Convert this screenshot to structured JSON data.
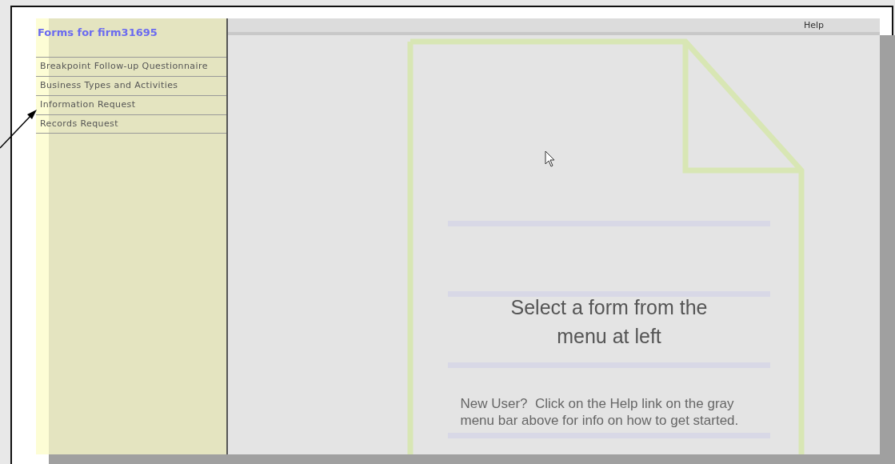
{
  "sidebar": {
    "title": "Forms for firm31695",
    "items": [
      {
        "label": "Breakpoint Follow-up Questionnaire"
      },
      {
        "label": "Business Types and Activities"
      },
      {
        "label": "Information Request"
      },
      {
        "label": "Records Request"
      }
    ]
  },
  "menu_bar": {
    "items": [
      "Help"
    ]
  },
  "main": {
    "heading": "Select a form from the menu at left",
    "hint": "New User?  Click on the Help link on the gray menu bar above for info on how to get started."
  }
}
